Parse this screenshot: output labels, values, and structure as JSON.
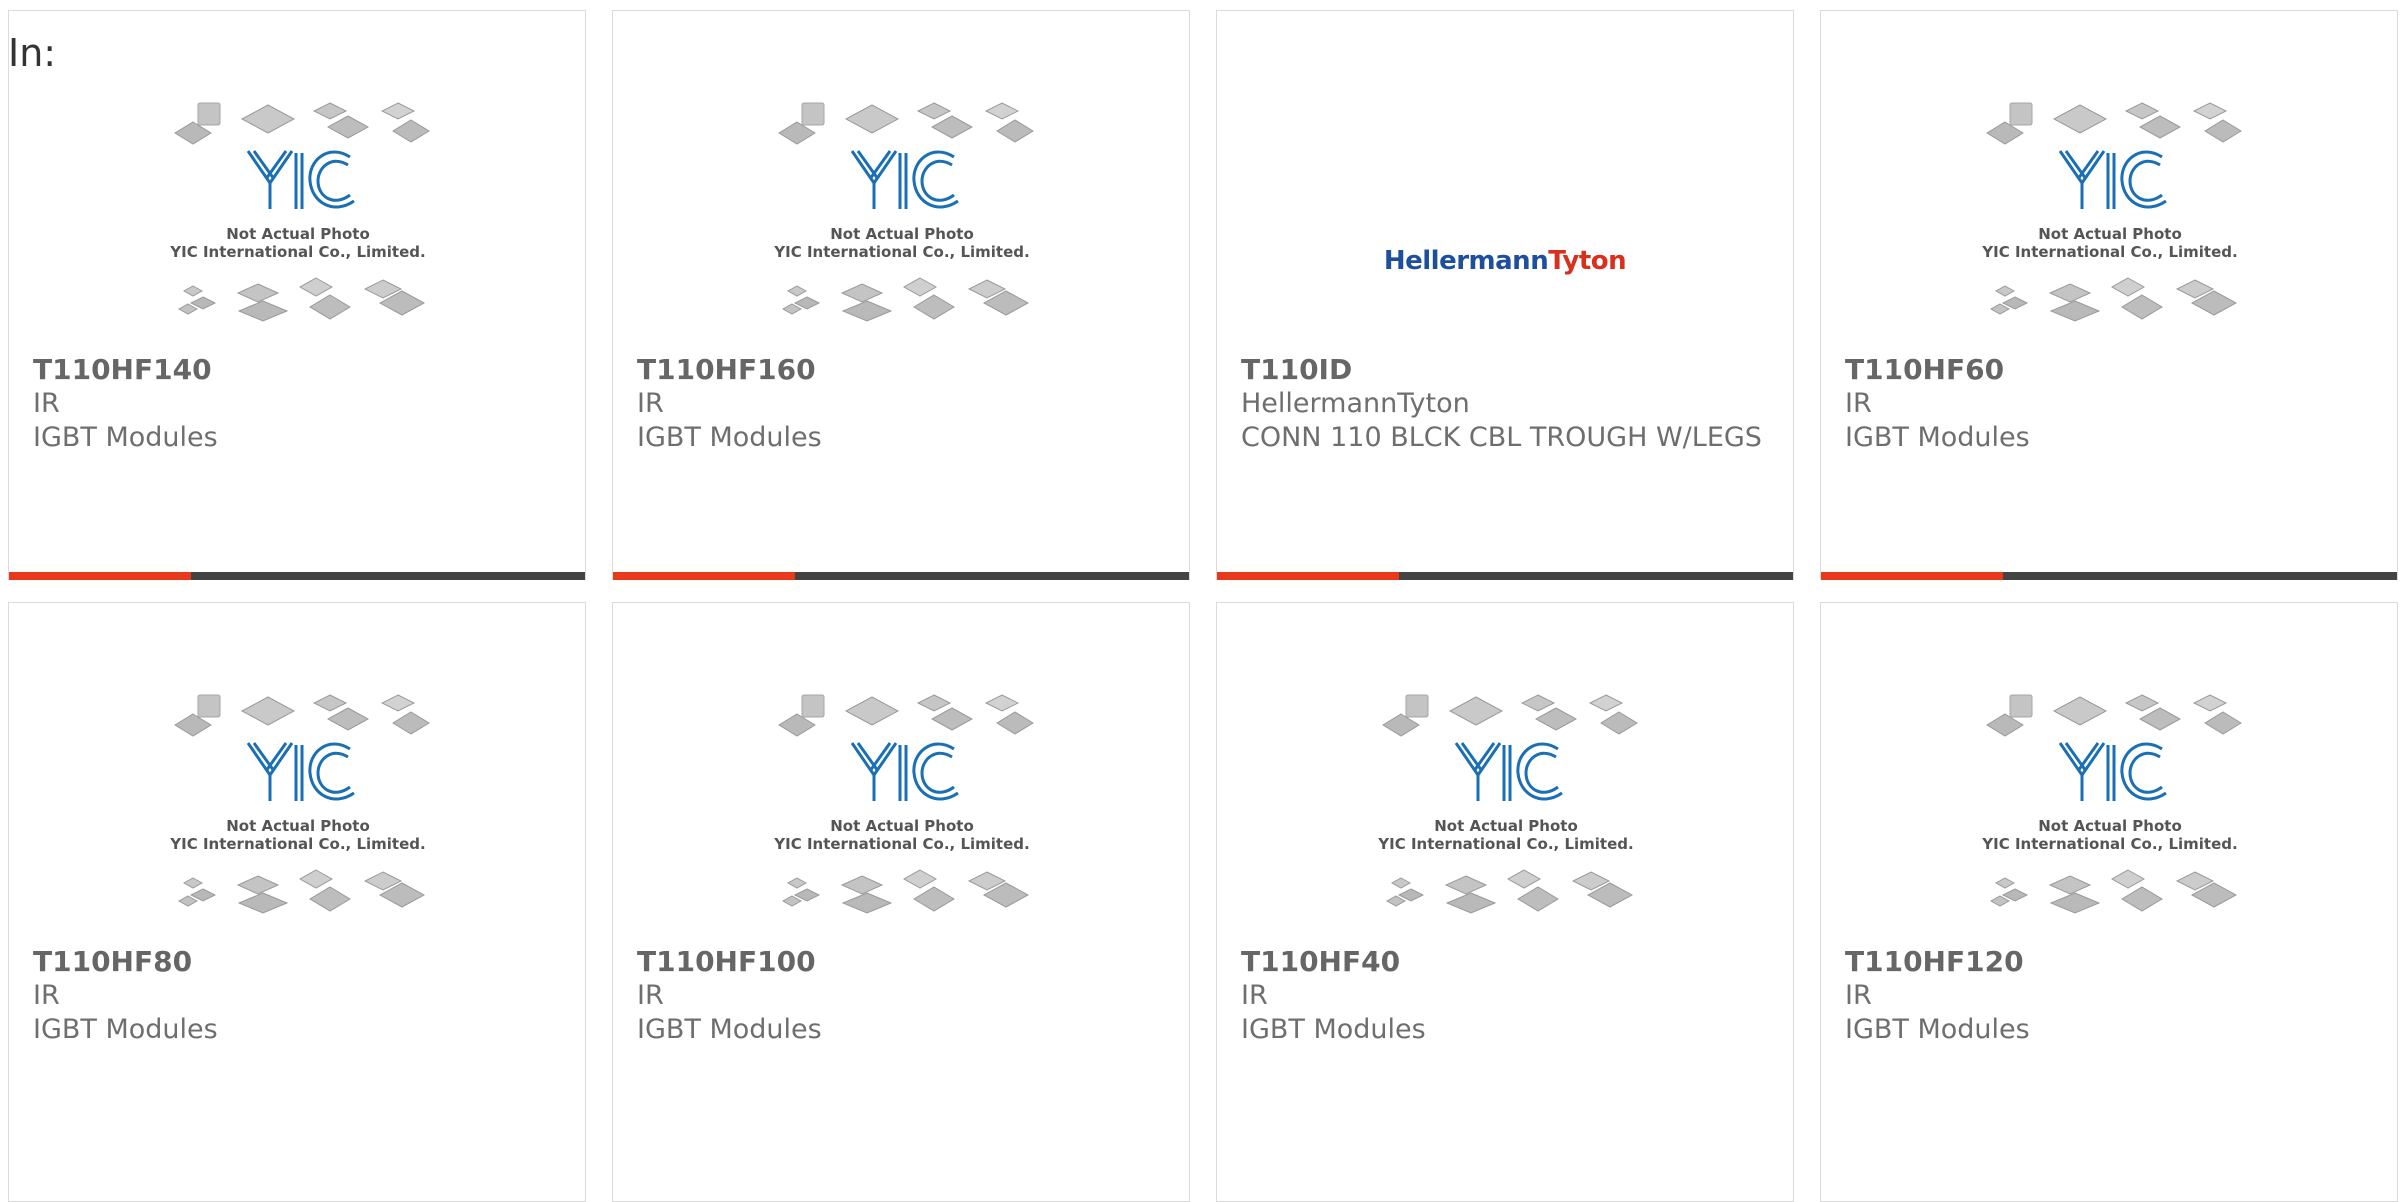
{
  "header": {
    "filter_label": "In:"
  },
  "placeholder_image": {
    "caption_line1": "Not Actual Photo",
    "caption_line2": "YIC International Co., Limited.",
    "logo_text": "YIC"
  },
  "colors": {
    "accent": "#e8391d",
    "bar": "#444444",
    "logo_blue": "#1a6fb5",
    "text_gray": "#6e6e6e"
  },
  "products": [
    {
      "part_number": "T110HF140",
      "manufacturer": "IR",
      "description": "IGBT Modules",
      "image": "yic-placeholder"
    },
    {
      "part_number": "T110HF160",
      "manufacturer": "IR",
      "description": "IGBT Modules",
      "image": "yic-placeholder"
    },
    {
      "part_number": "T110ID",
      "manufacturer": "HellermannTyton",
      "description": "CONN 110 BLCK CBL TROUGH W/LEGS",
      "image": "brand-logo",
      "brand_logo": {
        "part1": "Hellermann",
        "part2": "Tyton"
      }
    },
    {
      "part_number": "T110HF60",
      "manufacturer": "IR",
      "description": "IGBT Modules",
      "image": "yic-placeholder"
    },
    {
      "part_number": "T110HF80",
      "manufacturer": "IR",
      "description": "IGBT Modules",
      "image": "yic-placeholder"
    },
    {
      "part_number": "T110HF100",
      "manufacturer": "IR",
      "description": "IGBT Modules",
      "image": "yic-placeholder"
    },
    {
      "part_number": "T110HF40",
      "manufacturer": "IR",
      "description": "IGBT Modules",
      "image": "yic-placeholder"
    },
    {
      "part_number": "T110HF120",
      "manufacturer": "IR",
      "description": "IGBT Modules",
      "image": "yic-placeholder"
    }
  ]
}
